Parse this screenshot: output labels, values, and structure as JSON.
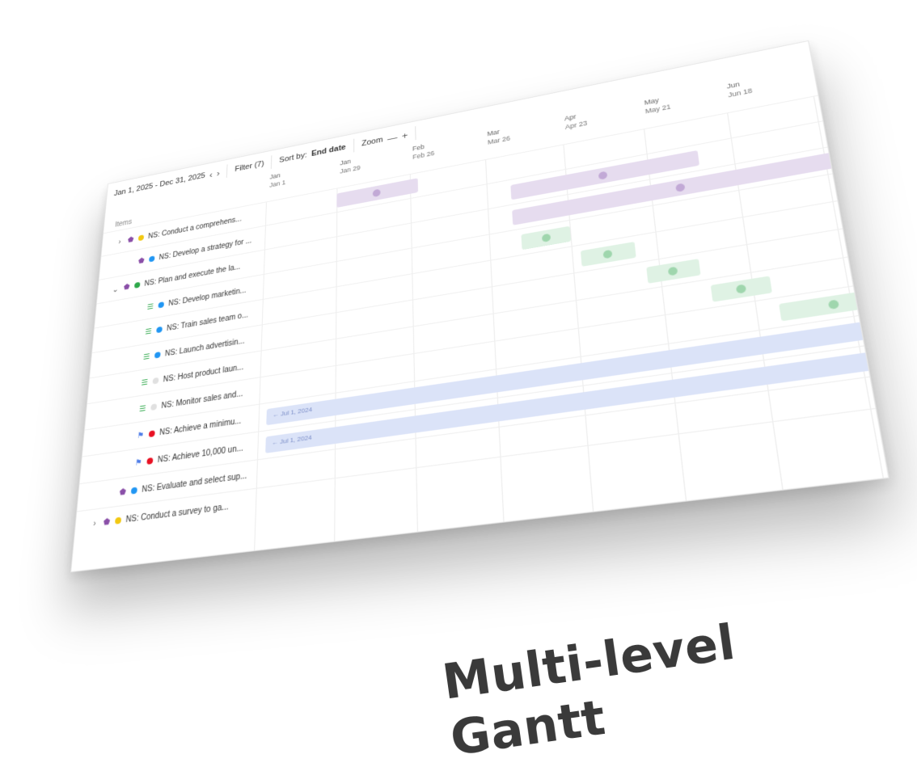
{
  "toolbar": {
    "date_range": "Jan 1, 2025 - Dec 31, 2025",
    "prev_icon": "chevron-left-icon",
    "next_icon": "chevron-right-icon",
    "filter_label": "Filter (7)",
    "sort_prefix": "Sort by:",
    "sort_value": "End date",
    "zoom_label": "Zoom",
    "zoom_out": "—",
    "zoom_in": "+"
  },
  "items_header": "Items",
  "timeline": {
    "columns": [
      {
        "month": "Jan",
        "date": "Jan 1"
      },
      {
        "month": "Jan",
        "date": "Jan 29"
      },
      {
        "month": "Feb",
        "date": "Feb 26"
      },
      {
        "month": "Mar",
        "date": "Mar 26"
      },
      {
        "month": "Apr",
        "date": "Apr 23"
      },
      {
        "month": "May",
        "date": "May 21"
      },
      {
        "month": "Jun",
        "date": "Jun 18"
      }
    ]
  },
  "rows": [
    {
      "label": "NS: Conduct a comprehens...",
      "chevron": "right",
      "type_icon": "pin-icon",
      "status_color": "#f2c811",
      "indent": 0
    },
    {
      "label": "NS: Develop a strategy for ...",
      "chevron": "",
      "type_icon": "pin-icon",
      "status_color": "#2196f3",
      "indent": 1
    },
    {
      "label": "NS: Plan and execute the la...",
      "chevron": "down",
      "type_icon": "pin-icon",
      "status_color": "#2ea84a",
      "indent": 0
    },
    {
      "label": "NS: Develop marketin...",
      "chevron": "",
      "type_icon": "checklist-icon",
      "status_color": "#2196f3",
      "indent": 2
    },
    {
      "label": "NS: Train sales team o...",
      "chevron": "",
      "type_icon": "checklist-icon",
      "status_color": "#2196f3",
      "indent": 2
    },
    {
      "label": "NS: Launch advertisin...",
      "chevron": "",
      "type_icon": "checklist-icon",
      "status_color": "#2196f3",
      "indent": 2
    },
    {
      "label": "NS: Host product laun...",
      "chevron": "",
      "type_icon": "checklist-icon",
      "status_color": "#e0e0e0",
      "indent": 2
    },
    {
      "label": "NS: Monitor sales and...",
      "chevron": "",
      "type_icon": "checklist-icon",
      "status_color": "#e0e0e0",
      "indent": 2
    },
    {
      "label": "NS: Achieve a minimu...",
      "chevron": "",
      "type_icon": "flag-icon",
      "status_color": "#e81123",
      "indent": 2
    },
    {
      "label": "NS: Achieve 10,000 un...",
      "chevron": "",
      "type_icon": "flag-icon",
      "status_color": "#e81123",
      "indent": 2
    },
    {
      "label": "NS: Evaluate and select sup...",
      "chevron": "",
      "type_icon": "pin-icon",
      "status_color": "#2196f3",
      "indent": 1
    },
    {
      "label": "NS: Conduct a survey to ga...",
      "chevron": "right",
      "type_icon": "pin-icon",
      "status_color": "#f2c811",
      "indent": 0
    }
  ],
  "bars": [
    {
      "row": 0,
      "start": 1.0,
      "end": 2.1,
      "color": "#e6dcef",
      "knob": "#c2a9d6",
      "text": ""
    },
    {
      "row": 1,
      "start": 3.3,
      "end": 5.6,
      "color": "#e6dcef",
      "knob": "#c2a9d6",
      "text": ""
    },
    {
      "row": 2,
      "start": 3.3,
      "end": 7.4,
      "color": "#e6dcef",
      "knob": "#c2a9d6",
      "text": ""
    },
    {
      "row": 3,
      "start": 3.4,
      "end": 4.0,
      "color": "#dff2e4",
      "knob": "#9fd6ad",
      "text": ""
    },
    {
      "row": 4,
      "start": 4.1,
      "end": 4.75,
      "color": "#dff2e4",
      "knob": "#9fd6ad",
      "text": ""
    },
    {
      "row": 5,
      "start": 4.85,
      "end": 5.45,
      "color": "#dff2e4",
      "knob": "#9fd6ad",
      "text": ""
    },
    {
      "row": 6,
      "start": 5.55,
      "end": 6.2,
      "color": "#dff2e4",
      "knob": "#9fd6ad",
      "text": ""
    },
    {
      "row": 7,
      "start": 6.25,
      "end": 7.4,
      "color": "#dff2e4",
      "knob": "#9fd6ad",
      "text": ""
    },
    {
      "row": 8,
      "start": 0.1,
      "end": 7.9,
      "color": "#dbe3f8",
      "knob": "",
      "text": "← Jul 1, 2024"
    },
    {
      "row": 9,
      "start": 0.1,
      "end": 7.9,
      "color": "#dbe3f8",
      "knob": "",
      "text": "← Jul 1, 2024"
    }
  ],
  "caption": "Multi-level Gantt"
}
